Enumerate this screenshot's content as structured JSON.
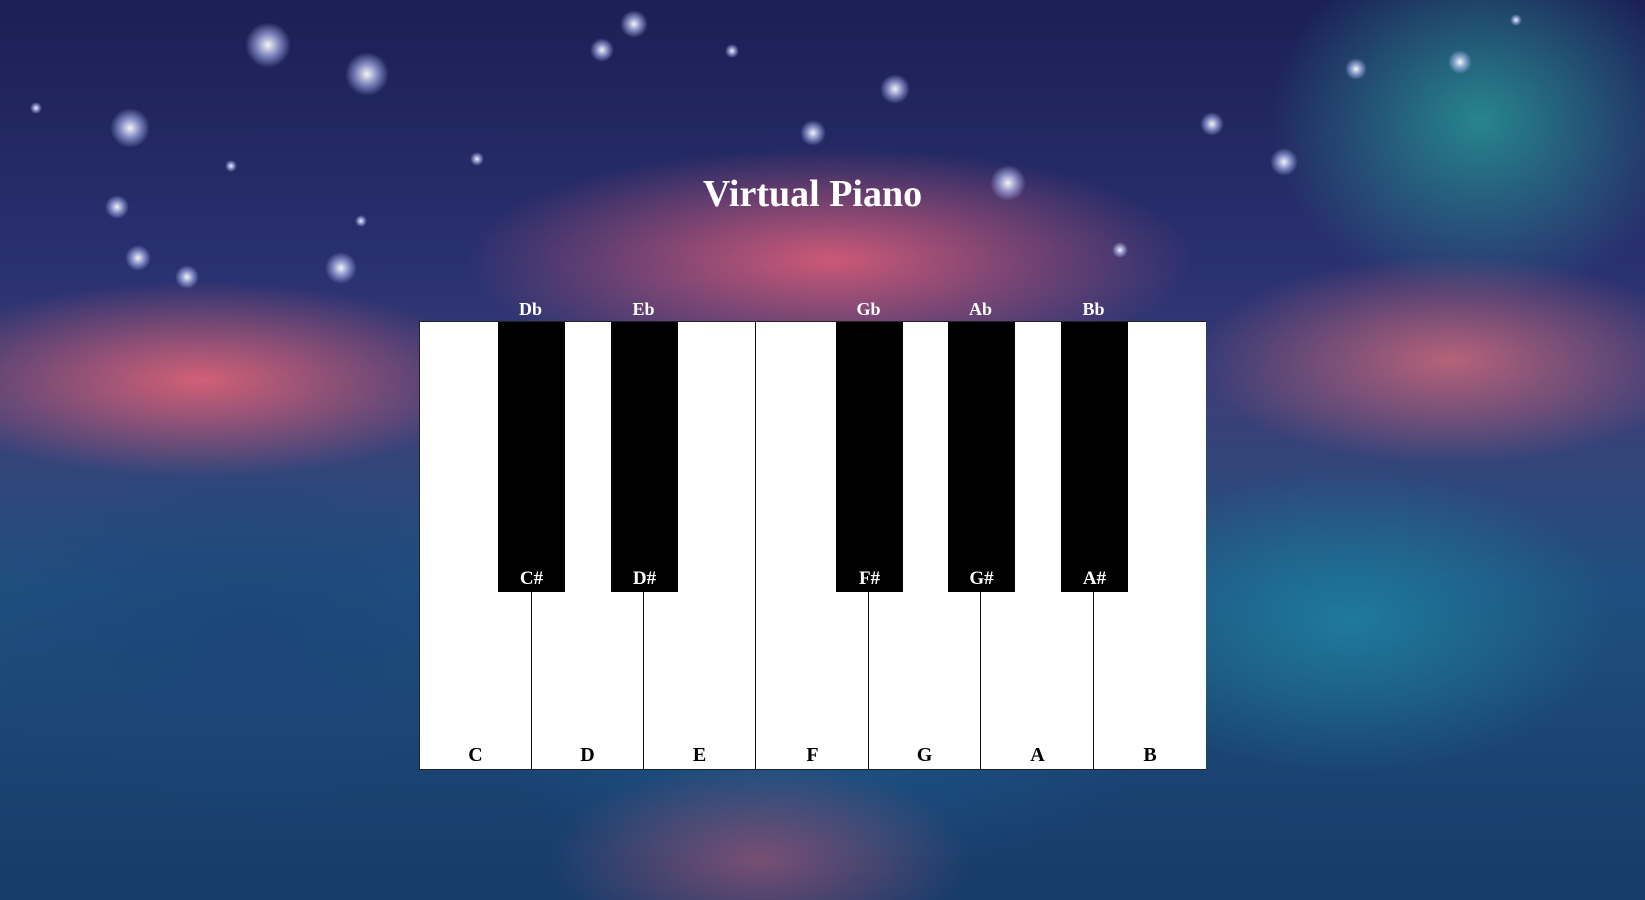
{
  "page": {
    "title": "Virtual Piano"
  },
  "piano": {
    "white_keys": [
      "C",
      "D",
      "E",
      "F",
      "G",
      "A",
      "B"
    ],
    "black_keys": [
      {
        "sharp": "C#",
        "flat": "Db"
      },
      {
        "sharp": "D#",
        "flat": "Eb"
      },
      {
        "sharp": "F#",
        "flat": "Gb"
      },
      {
        "sharp": "G#",
        "flat": "Ab"
      },
      {
        "sharp": "A#",
        "flat": "Bb"
      }
    ]
  },
  "colors": {
    "white_key": "#ffffff",
    "black_key": "#000000",
    "title": "#ffffff"
  }
}
